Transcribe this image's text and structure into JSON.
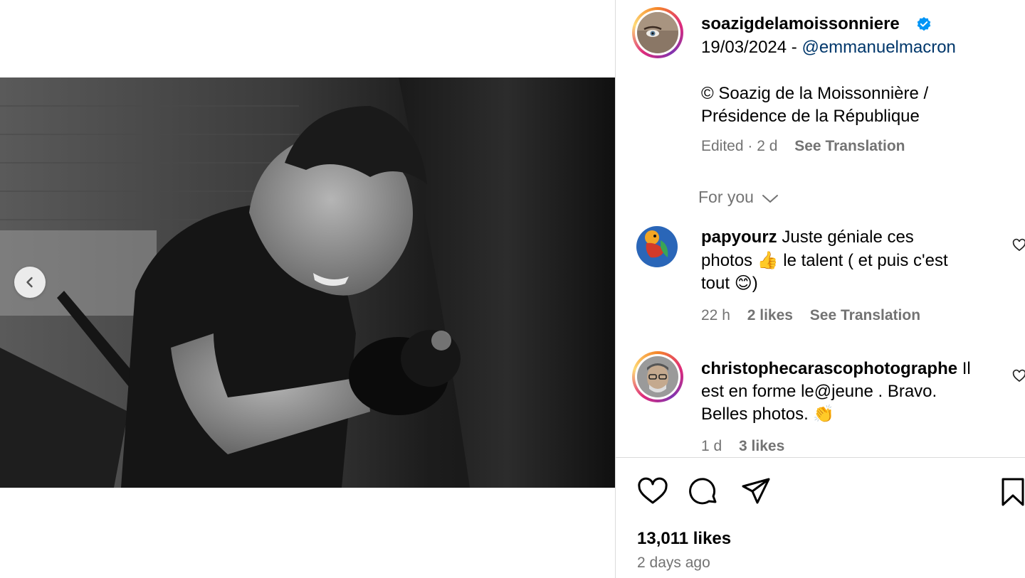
{
  "post": {
    "author": "soazigdelamoissonniere",
    "verified_icon": "verified-badge-icon",
    "date_line_prefix": "19/03/2024 -",
    "mention": "@emmanuelmacron",
    "caption_line1": "© Soazig de la Moissonnière /",
    "caption_line2": "Présidence de la République",
    "meta_edited": "Edited · 2 d",
    "meta_translate": "See Translation",
    "accent_color": "#0095f6"
  },
  "feed": {
    "for_you_label": "For you"
  },
  "comments": [
    {
      "author": "papyourz",
      "text_line1": "Juste géniale ces",
      "text_line2": "photos 👍 le talent ( et puis c'est",
      "text_line3": "tout 😊)",
      "time": "22 h",
      "likes": "2 likes",
      "translate": "See Translation"
    },
    {
      "author": "christophecarascophotographe",
      "text_line1": "Il",
      "text_line2": "est en forme le@jeune . Bravo.",
      "text_line3": "Belles photos. 👏",
      "time": "1 d",
      "likes": "3 likes"
    }
  ],
  "footer": {
    "likes_count": "13,011 likes",
    "posted_ago": "2 days ago"
  },
  "icons": {
    "prev": "chevron-left-icon",
    "like": "heart-icon",
    "comment": "comment-bubble-icon",
    "share": "paper-plane-icon",
    "save": "bookmark-icon"
  }
}
